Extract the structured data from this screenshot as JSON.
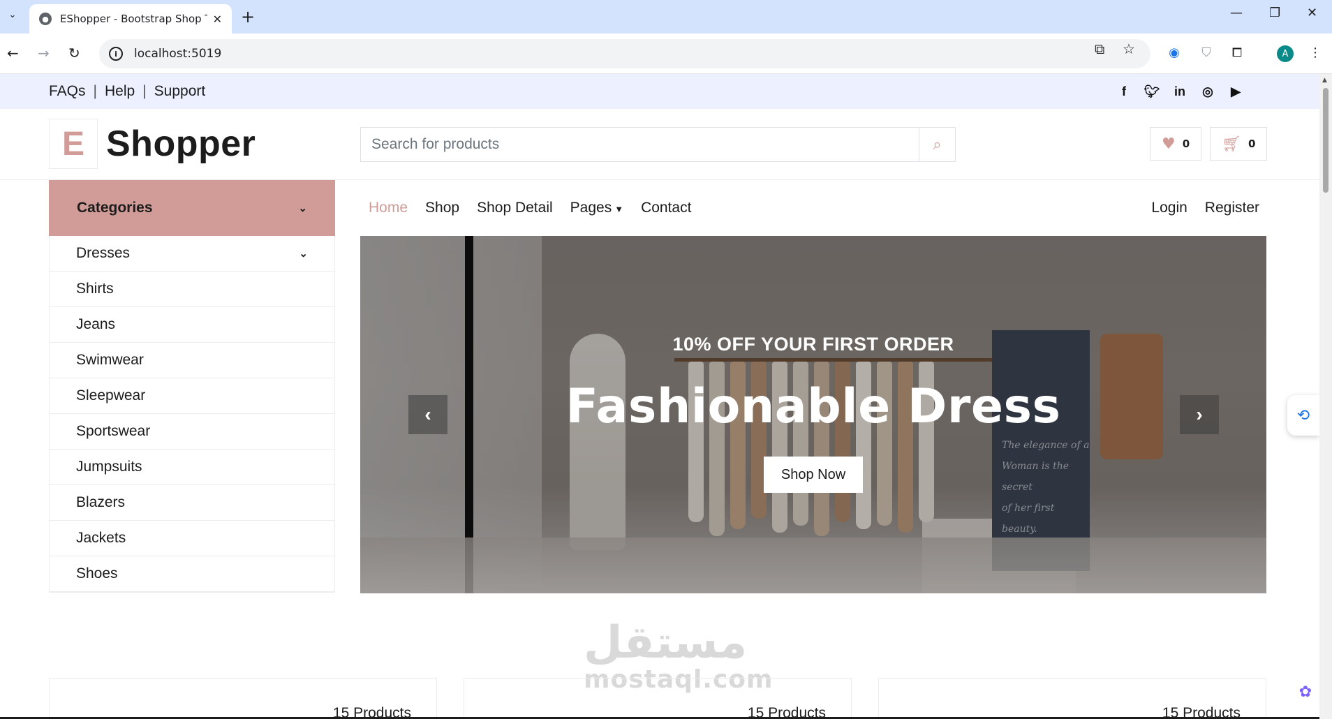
{
  "browser": {
    "tab_title": "EShopper - Bootstrap Shop Ten",
    "url": "localhost:5019",
    "profile_initial": "A"
  },
  "topbar": {
    "links": [
      "FAQs",
      "Help",
      "Support"
    ],
    "separator": "|",
    "social": [
      "facebook-icon",
      "twitter-icon",
      "linkedin-icon",
      "instagram-icon",
      "youtube-icon"
    ]
  },
  "header": {
    "logo_letter": "E",
    "logo_word": "Shopper",
    "search_placeholder": "Search for products",
    "wishlist_count": "0",
    "cart_count": "0"
  },
  "sidebar": {
    "heading": "Categories",
    "items": [
      "Dresses",
      "Shirts",
      "Jeans",
      "Swimwear",
      "Sleepwear",
      "Sportswear",
      "Jumpsuits",
      "Blazers",
      "Jackets",
      "Shoes"
    ]
  },
  "nav": {
    "links": [
      "Home",
      "Shop",
      "Shop Detail",
      "Pages",
      "Contact"
    ],
    "active": "Home",
    "auth": [
      "Login",
      "Register"
    ]
  },
  "carousel": {
    "subtitle": "10% OFF YOUR FIRST ORDER",
    "title": "Fashionable Dress",
    "button": "Shop Now",
    "panel_script": [
      "The elegance of a",
      "Woman is the secret",
      "of her first beauty."
    ]
  },
  "watermark": {
    "arabic": "مستقل",
    "latin": "mostaql.com"
  },
  "categories_cards": [
    {
      "count": "15 Products"
    },
    {
      "count": "15 Products"
    },
    {
      "count": "15 Products"
    }
  ],
  "colors": {
    "accent": "#d19c97",
    "topbar_bg": "#edf1ff",
    "chrome_bg": "#d3e3fd"
  }
}
